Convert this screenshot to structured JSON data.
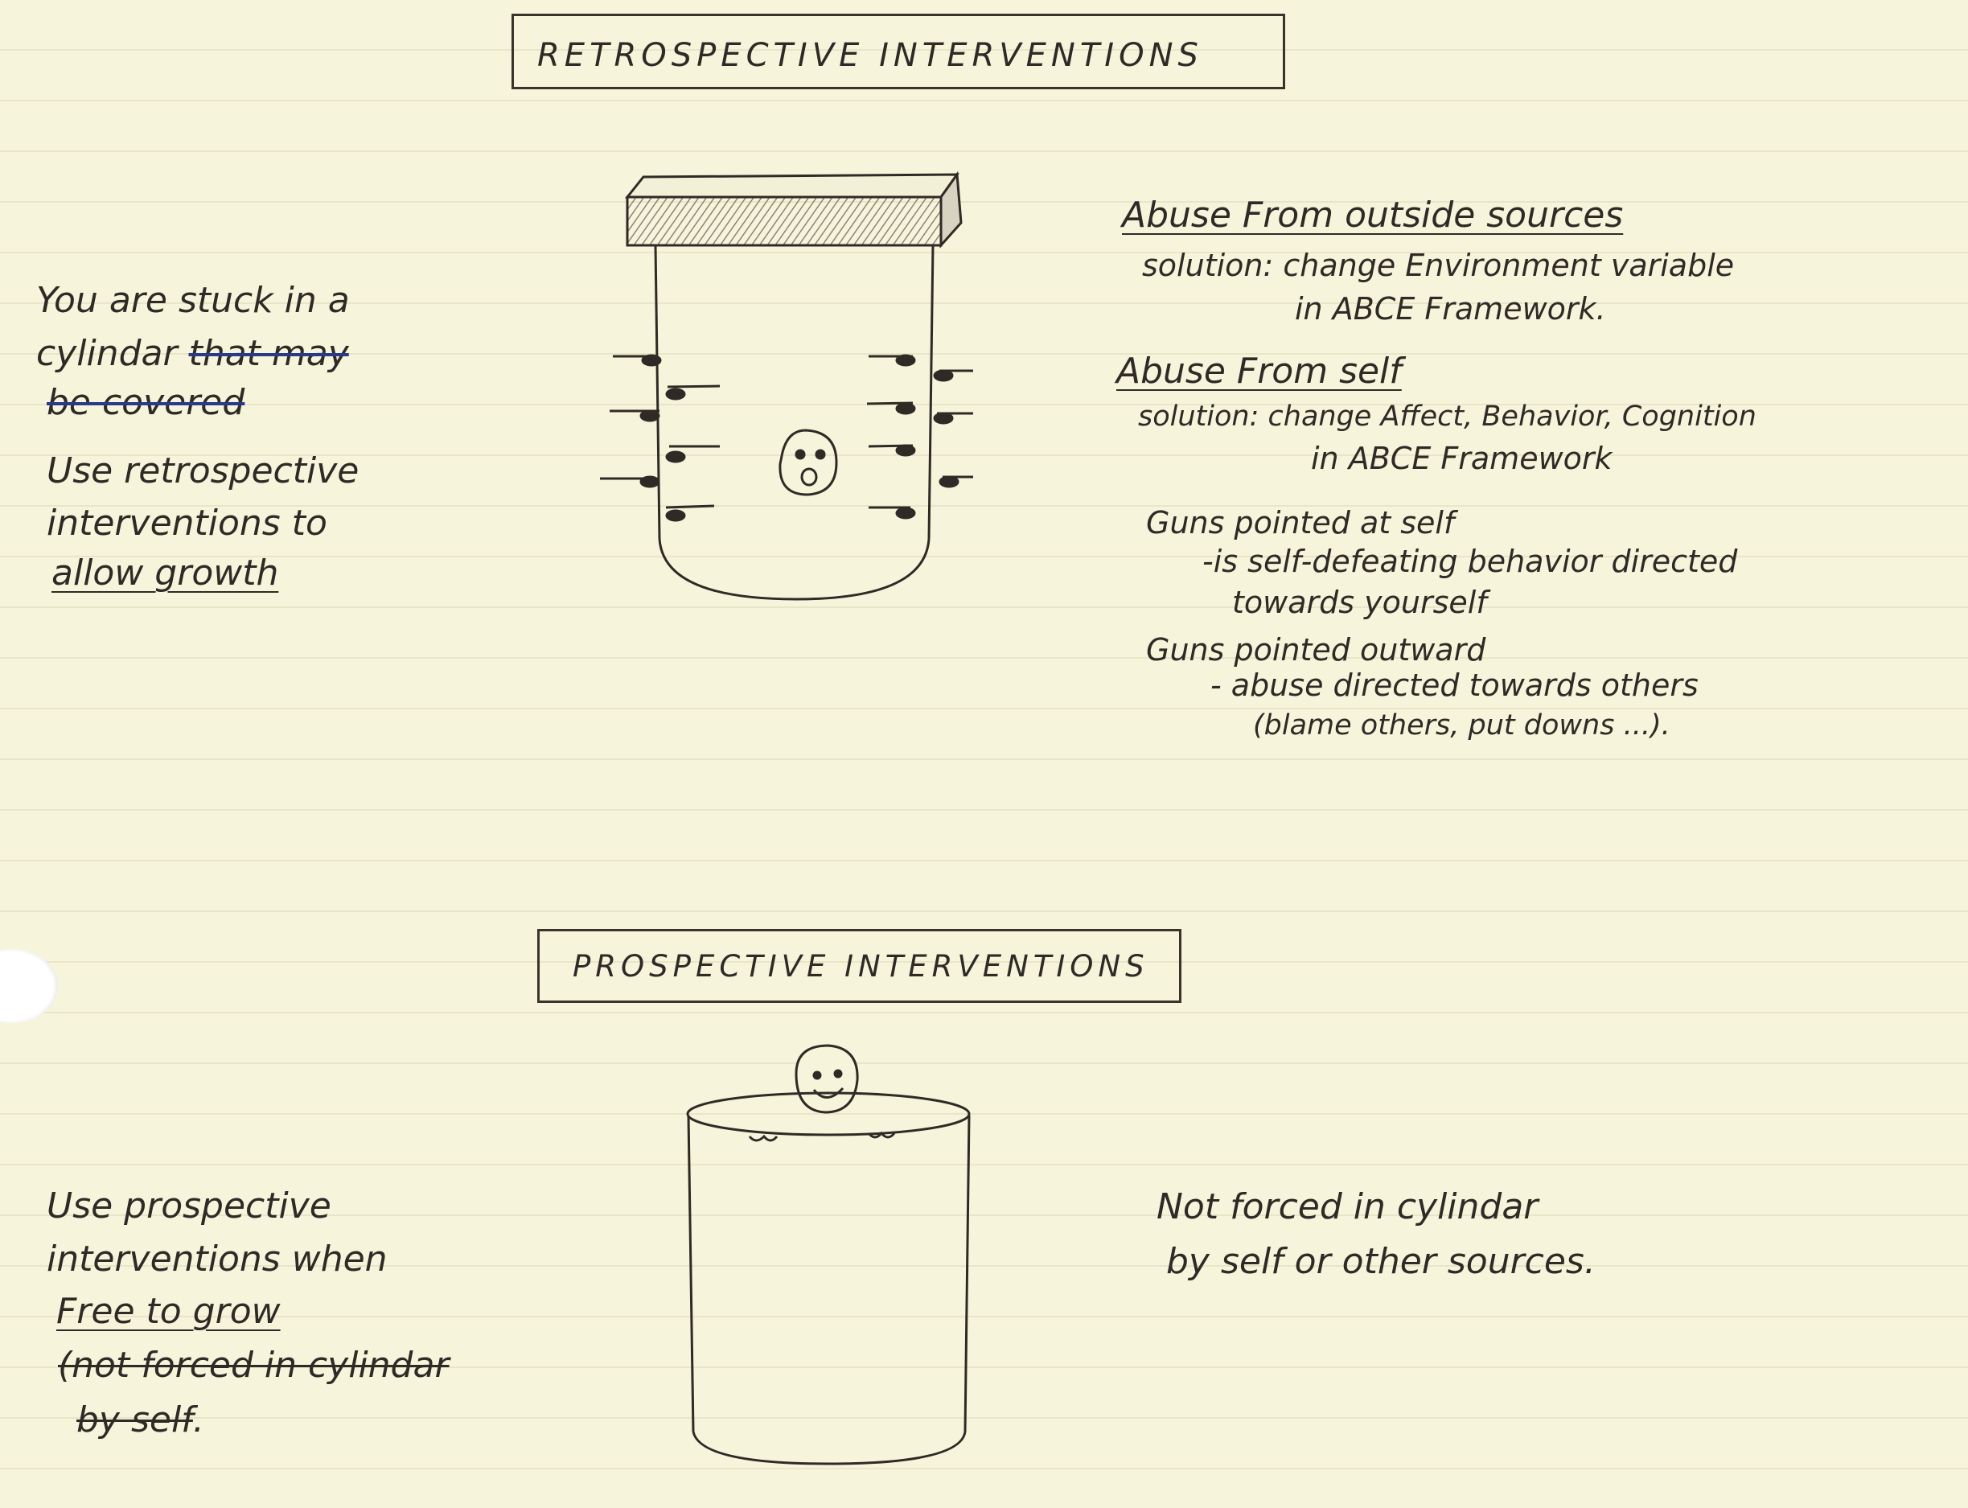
{
  "retrospective": {
    "title": "RETROSPECTIVE INTERVENTIONS",
    "left_note": {
      "line1": "You are stuck in a",
      "line2_kept": "cylindar",
      "line2_struck": "that may",
      "line3_struck": "be covered",
      "line4": "Use retrospective",
      "line5": "interventions to",
      "line6": "allow growth"
    },
    "outside": {
      "heading": "Abuse From outside sources",
      "line1": "solution: change Environment variable",
      "line2": "in ABCE Framework."
    },
    "self": {
      "heading": "Abuse From self",
      "line1": "solution: change Affect, Behavior, Cognition",
      "line2": "in ABCE Framework"
    },
    "guns_self": {
      "heading": "Guns pointed at self",
      "line1": "-is self-defeating behavior directed",
      "line2": "towards yourself"
    },
    "guns_out": {
      "heading": "Guns pointed outward",
      "line1": "- abuse directed towards others",
      "line2": "(blame others, put downs ...)."
    }
  },
  "prospective": {
    "title": "PROSPECTIVE INTERVENTIONS",
    "left_note": {
      "line1": "Use prospective",
      "line2": "interventions when",
      "line3": "Free to grow",
      "line4_struck": "(not forced in cylindar",
      "line5_struck": "by self",
      "line5_tail": "."
    },
    "right_note": {
      "line1": "Not forced in cylindar",
      "line2": "by self or other sources."
    }
  }
}
